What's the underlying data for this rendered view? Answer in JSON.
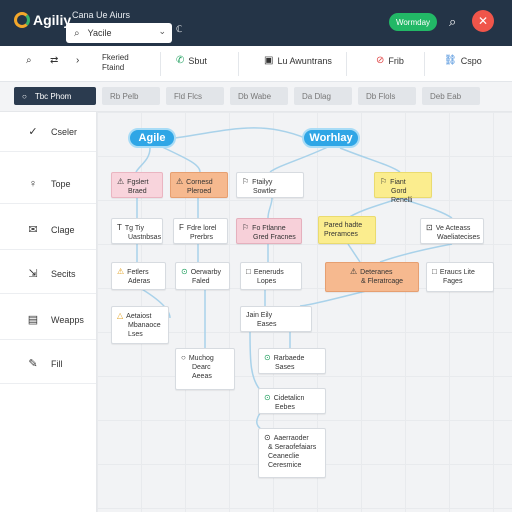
{
  "app": {
    "logo_text": "Agiliy",
    "title": "Cana Ue Aiurs",
    "search_value": "Yacile",
    "search_chevron": "⌄",
    "extra_button": "ℂ",
    "status_pill": "Wormday",
    "avatar_glyph": "✕"
  },
  "toolbar": {
    "items": [
      {
        "icon": "🔍",
        "label": "Q"
      },
      {
        "icon": "⇄",
        "label": ""
      },
      {
        "label_line1": "Fkeried",
        "label_line2": "Ftaind"
      },
      {
        "icon": "📞",
        "label": "Sbut"
      },
      {
        "icon": "▣",
        "label": "Lu Awuntrans"
      },
      {
        "icon": "⊘",
        "label": "Frib"
      },
      {
        "icon": "🔗",
        "label": "Cspo"
      }
    ]
  },
  "tabs": [
    {
      "label": "Tbc Phom"
    },
    {
      "label": "Rb Pelb"
    },
    {
      "label": "Fld Flcs"
    },
    {
      "label": "Db Wabe"
    },
    {
      "label": "Da Dlag"
    },
    {
      "label": "Db Flols"
    },
    {
      "label": "Deb Eab"
    }
  ],
  "sidebar": {
    "items": [
      {
        "icon": "✓",
        "label": "Cseler"
      },
      {
        "icon": "♀",
        "label": "Tope"
      },
      {
        "icon": "✉",
        "label": "Clage"
      },
      {
        "icon": "⇲",
        "label": "Secits"
      },
      {
        "icon": "▤",
        "label": "Weapps"
      },
      {
        "icon": "✎",
        "label": "Fill"
      }
    ]
  },
  "canvas": {
    "pill_left": "Agile",
    "pill_right": "Worhlay",
    "nodes": [
      {
        "icon": "⚠",
        "l1": "Fgslert",
        "l2": "Braed"
      },
      {
        "icon": "⚠",
        "l1": "Cornesd",
        "l2": "Pleroed"
      },
      {
        "icon": "⚐",
        "l1": "Ftailyy",
        "l2": "Sowtler"
      },
      {
        "icon": "⚐",
        "l1": "Fiant",
        "l2": "Gord Renelli"
      },
      {
        "icon": "T",
        "l1": "Tg Tiy",
        "l2": "Uastnbsas"
      },
      {
        "icon": "F",
        "l1": "Fdre lorel",
        "l2": "Prerbrs"
      },
      {
        "icon": "⚐",
        "l1": "Fo Ftlanne",
        "l2": "Gred Fracnes"
      },
      {
        "icon": "",
        "l1": "Pared hadte",
        "l2": "Preramces"
      },
      {
        "icon": "⊡",
        "l1": "Ve Acteass",
        "l2": "Waeliatecises"
      },
      {
        "icon": "⚠",
        "l1": "Fetlers",
        "l2": "Aderas"
      },
      {
        "icon": "⊙",
        "l1": "Oerwarby",
        "l2": "Faled"
      },
      {
        "icon": "□",
        "l1": "Eeneruds",
        "l2": "Lopes"
      },
      {
        "icon": "⚠",
        "l1": "Deteranes",
        "l2": "& Fleratrcage"
      },
      {
        "icon": "□",
        "l1": "Eraucs Lite",
        "l2": "Fages"
      },
      {
        "icon": "△",
        "l1": "Aetaiost",
        "l2": "Mbanaoce",
        "l3": "Lses"
      },
      {
        "icon": "",
        "l1": "Jain Eily",
        "l2": "Eases"
      },
      {
        "icon": "○",
        "l1": "Muchog",
        "l2": "Dearc",
        "l3": "Aeeas"
      },
      {
        "icon": "⊙",
        "l1": "Rarbaede",
        "l2": "Sases"
      },
      {
        "icon": "⊙",
        "l1": "Cidetalicn",
        "l2": "Eebes"
      },
      {
        "icon": "⊙",
        "l1": "Aaerraoder",
        "l2": "& Seraofefaiars",
        "l3": "Ceaneclie",
        "l4": "Ceresmice"
      }
    ]
  },
  "colors": {
    "topbar": "#243447",
    "accent_blue": "#2fa6e6",
    "accent_green": "#22b866",
    "avatar_red": "#f0554a",
    "node_pink": "#f8d4dc",
    "node_orange": "#f6b98f",
    "node_yellow": "#fbed8e",
    "link_line": "#a9d2ea"
  }
}
